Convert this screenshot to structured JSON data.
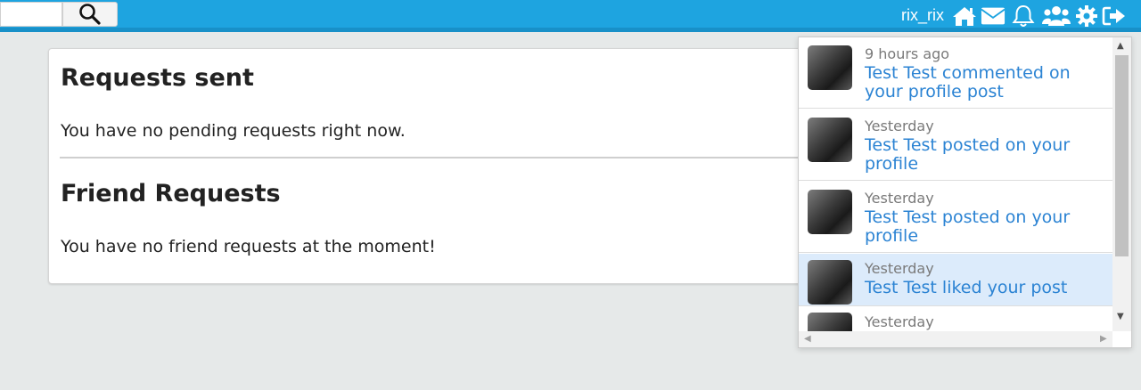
{
  "header": {
    "search": {
      "placeholder": "",
      "value": ""
    },
    "username": "rix_rix",
    "icons": [
      "home-icon",
      "envelope-icon",
      "bell-icon",
      "users-icon",
      "gear-icon",
      "logout-icon"
    ],
    "colors": {
      "bar": "#1ea4e0",
      "bar_border": "#1890c8"
    }
  },
  "main": {
    "sent_title": "Requests sent",
    "sent_text": "You have no pending requests right now.",
    "friend_title": "Friend Requests",
    "friend_text": "You have no friend requests at the moment!"
  },
  "notifications": {
    "items": [
      {
        "time": "9 hours ago",
        "message": "Test Test commented on your profile post"
      },
      {
        "time": "Yesterday",
        "message": "Test Test posted on your profile"
      },
      {
        "time": "Yesterday",
        "message": "Test Test posted on your profile"
      },
      {
        "time": "Yesterday",
        "message": "Test Test liked your post"
      },
      {
        "time": "Yesterday",
        "message": ""
      }
    ]
  }
}
